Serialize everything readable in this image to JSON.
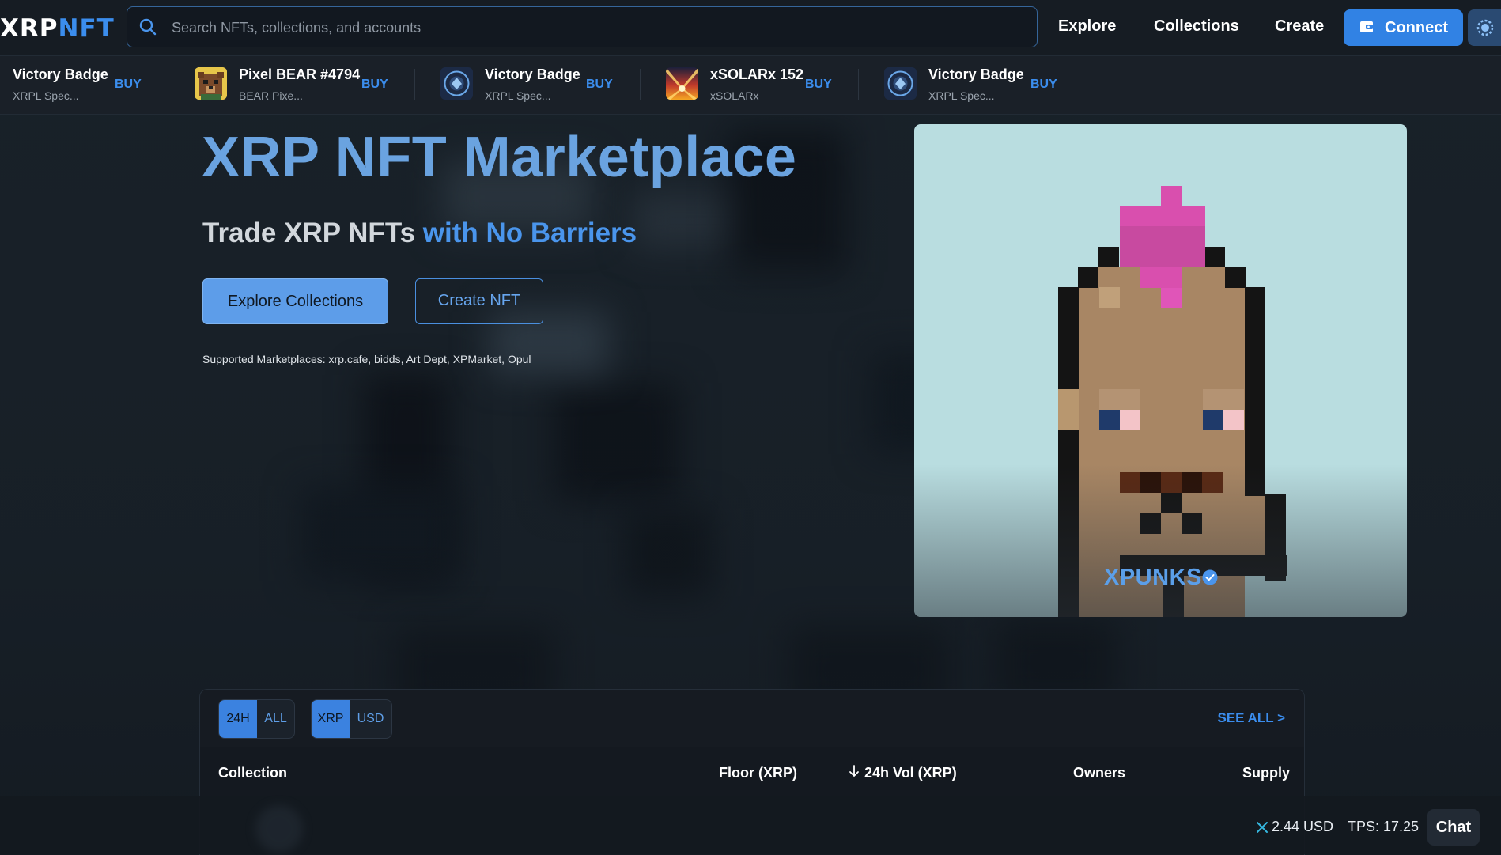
{
  "header": {
    "logo_part1": "XRP",
    "logo_part2": "NFT",
    "search_placeholder": "Search NFTs, collections, and accounts",
    "nav": [
      "Explore",
      "Collections",
      "Create"
    ],
    "connect_label": "Connect",
    "accent_color": "#3b8ded"
  },
  "ticker": [
    {
      "name": "Victory Badge",
      "sub": "XRPL Spec...",
      "action": "BUY"
    },
    {
      "name": "Pixel BEAR #4794",
      "sub": "BEAR Pixe...",
      "action": "BUY"
    },
    {
      "name": "Victory Badge",
      "sub": "XRPL Spec...",
      "action": "BUY"
    },
    {
      "name": "xSOLARx 152",
      "sub": "xSOLARx",
      "action": "BUY"
    },
    {
      "name": "Victory Badge",
      "sub": "XRPL Spec...",
      "action": "BUY"
    }
  ],
  "hero": {
    "title": "XRP NFT Marketplace",
    "subtitle_part1": "Trade XRP NFTs ",
    "subtitle_part2": "with No Barriers",
    "explore_button": "Explore Collections",
    "create_button": "Create NFT",
    "supported": "Supported Marketplaces: xrp.cafe, bidds, Art Dept, XPMarket, Opul"
  },
  "featured": {
    "collection_name": "XPUNKS",
    "verified": true
  },
  "stats": {
    "time_filter": {
      "options": [
        "24H",
        "ALL"
      ],
      "selected": "24H"
    },
    "currency_filter": {
      "options": [
        "XRP",
        "USD"
      ],
      "selected": "XRP"
    },
    "see_all": "SEE ALL >",
    "columns": [
      "Collection",
      "Floor (XRP)",
      "24h Vol (XRP)",
      "Owners",
      "Supply"
    ],
    "sorted_column": "24h Vol (XRP)"
  },
  "statusbar": {
    "xrp_price": "2.44 USD",
    "tps": "TPS: 17.25",
    "chat_label": "Chat"
  }
}
